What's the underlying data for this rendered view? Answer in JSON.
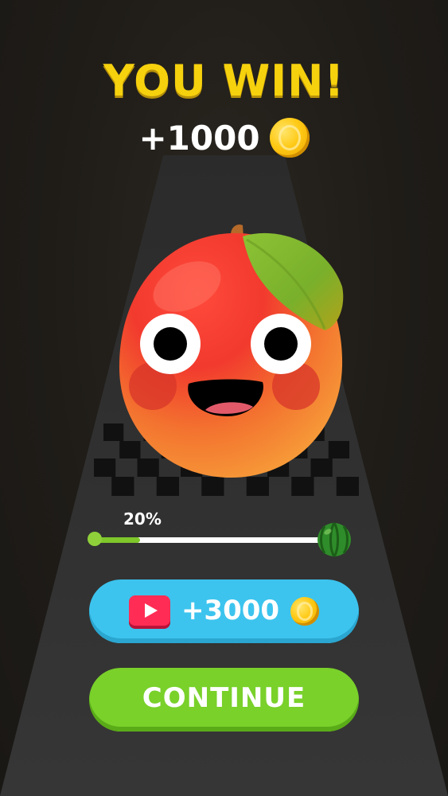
{
  "result": {
    "title": "YOU WIN!",
    "reward_label": "+1000",
    "reward_icon": "coin-icon"
  },
  "character": {
    "name_icon": "mango-character"
  },
  "progress": {
    "label": "20%",
    "value": 0.2,
    "goal_icon": "watermelon-icon",
    "fill_color": "#7fc72a"
  },
  "buttons": {
    "ad_reward_label": "+3000",
    "ad_icon": "play-video-icon",
    "ad_color": "#3cc4ee",
    "continue_label": "CONTINUE",
    "continue_color": "#79d12a"
  },
  "colors": {
    "title": "#f6d10d",
    "background": "#1f1c18",
    "road": "#333333"
  }
}
